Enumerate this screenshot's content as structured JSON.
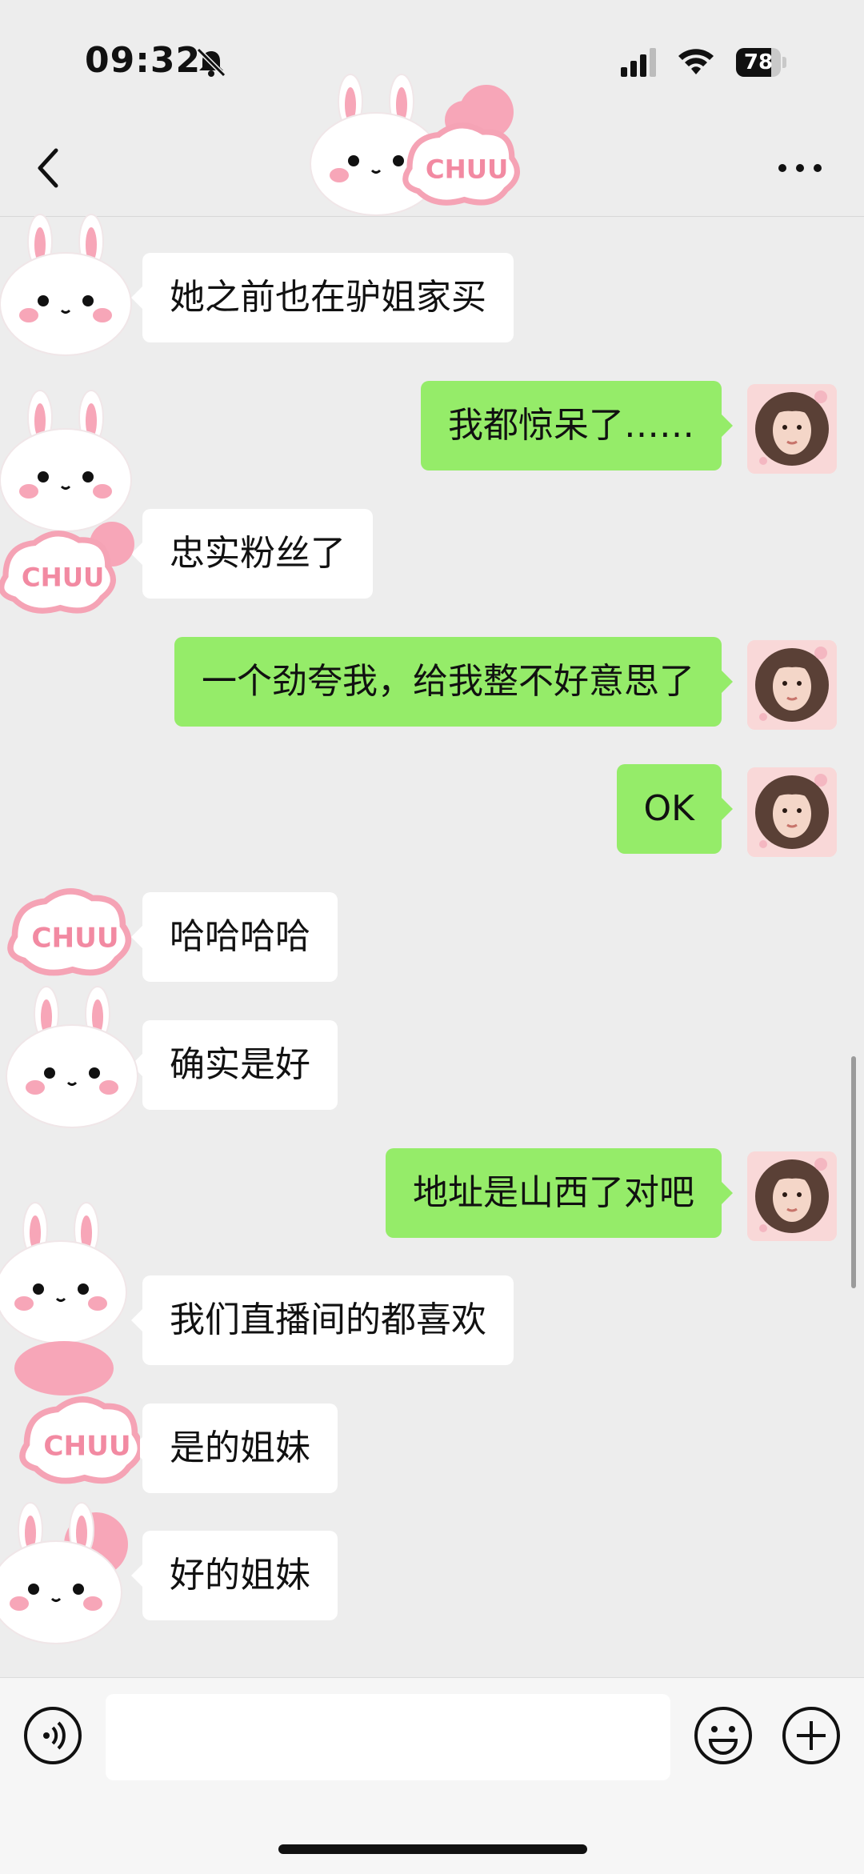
{
  "status_bar": {
    "time": "09:32",
    "battery": "78",
    "battery_level": 0.78,
    "icons": [
      "bell-muted-icon",
      "cellular-signal-icon",
      "wifi-icon",
      "battery-icon"
    ]
  },
  "nav": {
    "back_icon": "chevron-left-icon",
    "more_icon": "ellipsis-icon",
    "sticker_text": "CHUU"
  },
  "messages": [
    {
      "side": "in",
      "text": "她之前也在驴姐家买"
    },
    {
      "side": "out",
      "text": "我都惊呆了……"
    },
    {
      "side": "in",
      "text": "忠实粉丝了"
    },
    {
      "side": "out",
      "text": "一个劲夸我，给我整不好意思了"
    },
    {
      "side": "out",
      "text": "OK"
    },
    {
      "side": "in",
      "text": "哈哈哈哈"
    },
    {
      "side": "in",
      "text": "确实是好"
    },
    {
      "side": "out",
      "text": "地址是山西了对吧"
    },
    {
      "side": "in",
      "text": "我们直播间的都喜欢"
    },
    {
      "side": "in",
      "text": "是的姐妹"
    },
    {
      "side": "in",
      "text": "好的姐妹"
    }
  ],
  "input_bar": {
    "voice_icon": "voice-icon",
    "text_value": "",
    "emoji_icon": "emoji-icon",
    "plus_icon": "plus-circle-icon"
  },
  "colors": {
    "outgoing_bubble": "#95ec69",
    "incoming_bubble": "#ffffff",
    "background": "#ededed",
    "sticker_pink": "#f5a3b5"
  }
}
